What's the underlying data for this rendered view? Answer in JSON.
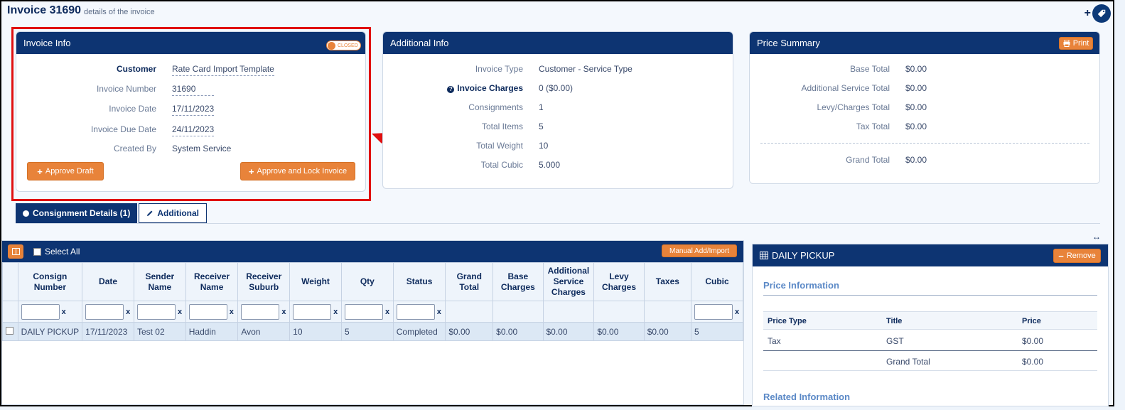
{
  "page": {
    "title": "Invoice 31690",
    "subtitle": "details of the invoice"
  },
  "invoice_info": {
    "title": "Invoice Info",
    "status": "CLOSED",
    "fields": [
      {
        "label": "Customer",
        "value": "Rate Card Import Template"
      },
      {
        "label": "Invoice Number",
        "value": "31690"
      },
      {
        "label": "Invoice Date",
        "value": "17/11/2023"
      },
      {
        "label": "Invoice Due Date",
        "value": "24/11/2023"
      },
      {
        "label": "Created By",
        "value": "System Service"
      }
    ],
    "approve_draft": "Approve Draft",
    "approve_lock": "Approve and Lock Invoice"
  },
  "additional_info": {
    "title": "Additional Info",
    "fields": [
      {
        "label": "Invoice Type",
        "value": "Customer - Service Type"
      },
      {
        "label": "Invoice Charges",
        "value": "0 ($0.00)"
      },
      {
        "label": "Consignments",
        "value": "1"
      },
      {
        "label": "Total Items",
        "value": "5"
      },
      {
        "label": "Total Weight",
        "value": "10"
      },
      {
        "label": "Total Cubic",
        "value": "5.000"
      }
    ]
  },
  "price_summary": {
    "title": "Price Summary",
    "print_label": "Print",
    "fields": [
      {
        "label": "Base Total",
        "value": "$0.00"
      },
      {
        "label": "Additional Service Total",
        "value": "$0.00"
      },
      {
        "label": "Levy/Charges Total",
        "value": "$0.00"
      },
      {
        "label": "Tax Total",
        "value": "$0.00"
      }
    ],
    "grand_total_label": "Grand Total",
    "grand_total_value": "$0.00"
  },
  "tabs": [
    {
      "label": "Consignment Details (1)",
      "active": true
    },
    {
      "label": "Additional",
      "active": false
    }
  ],
  "grid": {
    "select_all": "Select All",
    "manual_add": "Manual Add/Import",
    "columns": [
      "Consign Number",
      "Date",
      "Sender Name",
      "Receiver Name",
      "Receiver Suburb",
      "Weight",
      "Qty",
      "Status",
      "Grand Total",
      "Base Charges",
      "Additional Service Charges",
      "Levy Charges",
      "Taxes",
      "Cubic"
    ],
    "rows": [
      [
        "DAILY PICKUP",
        "17/11/2023",
        "Test 02",
        "Haddin",
        "Avon",
        "10",
        "5",
        "Completed",
        "$0.00",
        "$0.00",
        "$0.00",
        "$0.00",
        "$0.00",
        "5"
      ]
    ]
  },
  "side_panel": {
    "title": "DAILY PICKUP",
    "remove_label": "Remove",
    "price_info_title": "Price Information",
    "price_headers": [
      "Price Type",
      "Title",
      "Price"
    ],
    "price_rows": [
      [
        "Tax",
        "GST",
        "$0.00"
      ]
    ],
    "grand_total_label": "Grand Total",
    "grand_total_value": "$0.00",
    "related_title": "Related Information"
  }
}
